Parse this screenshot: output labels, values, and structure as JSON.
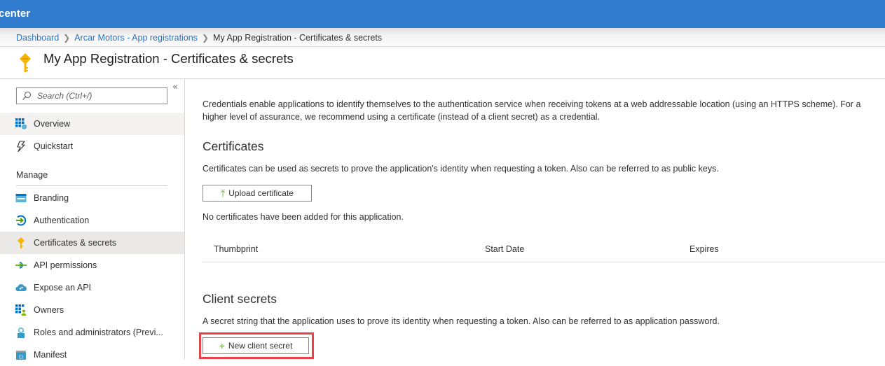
{
  "topbar": {
    "brand": "center",
    "color": "#327cd0"
  },
  "breadcrumb": {
    "items": [
      {
        "label": "Dashboard",
        "link": true
      },
      {
        "label": "Arcar Motors - App registrations",
        "link": true
      },
      {
        "label": "My App Registration - Certificates & secrets",
        "link": false
      }
    ],
    "separator": ">"
  },
  "page": {
    "title": "My App Registration - Certificates & secrets",
    "icon": "key-icon"
  },
  "sidebar": {
    "search_placeholder": "Search (Ctrl+/)",
    "collapse_label": "«",
    "items_top": [
      {
        "label": "Overview",
        "icon": "overview-grid-icon",
        "state": "hover"
      },
      {
        "label": "Quickstart",
        "icon": "lightning-icon",
        "state": ""
      }
    ],
    "group_label": "Manage",
    "items_manage": [
      {
        "label": "Branding",
        "icon": "branding-www-icon",
        "state": ""
      },
      {
        "label": "Authentication",
        "icon": "authentication-icon",
        "state": ""
      },
      {
        "label": "Certificates & secrets",
        "icon": "key-icon",
        "state": "selected"
      },
      {
        "label": "API permissions",
        "icon": "api-permissions-icon",
        "state": ""
      },
      {
        "label": "Expose an API",
        "icon": "cloud-icon",
        "state": ""
      },
      {
        "label": "Owners",
        "icon": "owners-icon",
        "state": ""
      },
      {
        "label": "Roles and administrators (Previ...",
        "icon": "roles-icon",
        "state": ""
      },
      {
        "label": "Manifest",
        "icon": "manifest-icon",
        "state": ""
      }
    ]
  },
  "content": {
    "intro": "Credentials enable applications to identify themselves to the authentication service when receiving tokens at a web addressable location (using an HTTPS scheme). For a higher level of assurance, we recommend using a certificate (instead of a client secret) as a credential.",
    "certificates": {
      "title": "Certificates",
      "description": "Certificates can be used as secrets to prove the application's identity when requesting a token. Also can be referred to as public keys.",
      "upload_button": "Upload certificate",
      "empty_message": "No certificates have been added for this application.",
      "columns": [
        "Thumbprint",
        "Start Date",
        "Expires"
      ]
    },
    "client_secrets": {
      "title": "Client secrets",
      "description": "A secret string that the application uses to prove its identity when requesting a token. Also can be referred to as application password.",
      "new_button": "New client secret",
      "highlight_color": "#e8434a"
    }
  }
}
